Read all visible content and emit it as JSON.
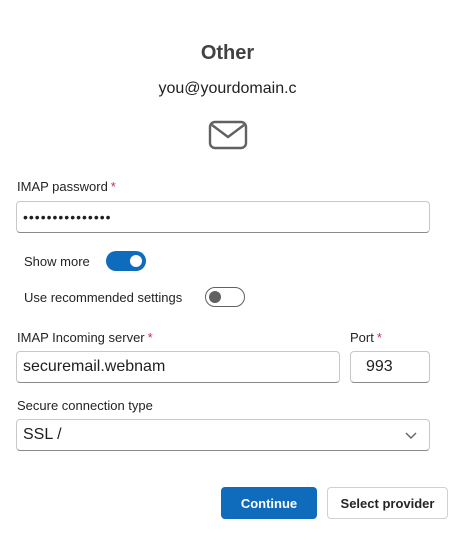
{
  "header": {
    "title": "Other",
    "email": "you@yourdomain.c",
    "icon": "mail-icon"
  },
  "password": {
    "label": "IMAP password",
    "required_mark": "*",
    "value": "•••••••••••••••"
  },
  "toggles": {
    "show_more": {
      "label": "Show more",
      "state": "on"
    },
    "recommended": {
      "label": "Use recommended settings",
      "state": "off"
    }
  },
  "incoming_server": {
    "label": "IMAP Incoming server",
    "required_mark": "*",
    "value": "securemail.webnam"
  },
  "port": {
    "label": "Port",
    "required_mark": "*",
    "value": "993"
  },
  "secure_connection": {
    "label": "Secure connection type",
    "value": "SSL /",
    "icon": "chevron-down-icon"
  },
  "buttons": {
    "continue": "Continue",
    "select_provider": "Select provider"
  },
  "colors": {
    "accent": "#0f6cbd",
    "required": "#c4314b"
  }
}
